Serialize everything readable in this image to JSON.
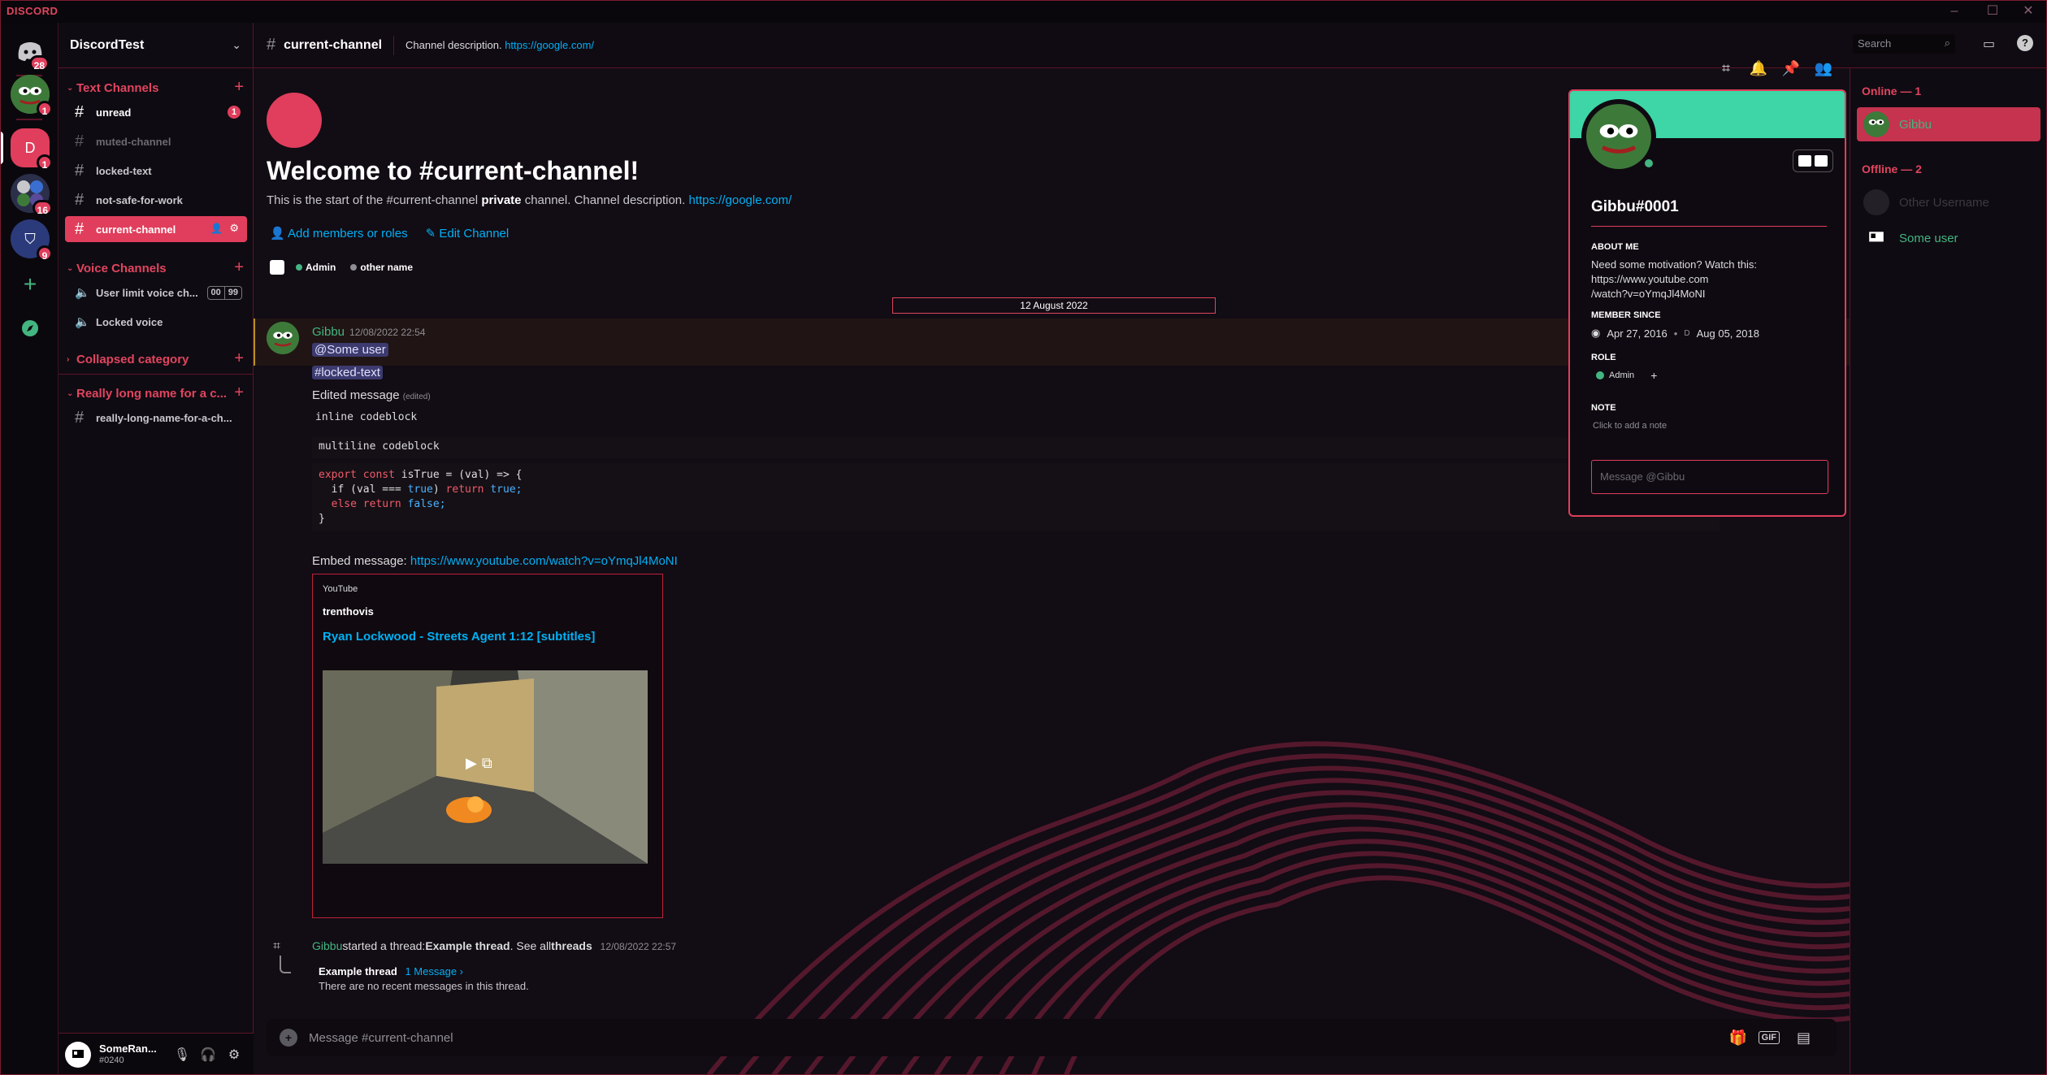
{
  "app": {
    "brand": "DISCORD"
  },
  "servers": {
    "home_badge": "28",
    "srv1_badge": "1",
    "srv2_initial": "D",
    "srv2_badge": "1",
    "srv3_badge": "16",
    "srv4_badge": "9"
  },
  "guild": {
    "name": "DiscordTest"
  },
  "categories": {
    "text": "Text Channels",
    "voice": "Voice Channels",
    "collapsed": "Collapsed category",
    "long": "Really long name for a c..."
  },
  "channels": {
    "unread": "unread",
    "unread_badge": "1",
    "muted": "muted-channel",
    "locked": "locked-text",
    "nsfw": "not-safe-for-work",
    "current": "current-channel",
    "voice_limit": "User limit voice ch...",
    "voice_limit_count": "00",
    "voice_limit_max": "99",
    "voice_locked": "Locked voice",
    "long_channel": "really-long-name-for-a-ch..."
  },
  "user": {
    "name": "SomeRan...",
    "tag": "#0240"
  },
  "topbar": {
    "channel": "current-channel",
    "description": "Channel description.",
    "link": "https://google.com/",
    "search_placeholder": "Search"
  },
  "welcome": {
    "title": "Welcome to #current-channel!",
    "sub_pre": "This is the start of the #current-channel",
    "sub_bold": "private",
    "sub_post": "channel. Channel description.",
    "sub_link": "https://google.com/",
    "add_members": "Add members or roles",
    "edit_channel": "Edit Channel",
    "role_admin": "Admin",
    "role_other": "other name"
  },
  "date_separator": "12 August 2022",
  "message": {
    "author": "Gibbu",
    "timestamp": "12/08/2022 22:54",
    "mention_user": "@Some user",
    "mention_channel": "#locked-text",
    "edited_text": "Edited message",
    "edited_tag": "(edited)",
    "inline_code": "inline codeblock",
    "multiline_code": "multiline codeblock",
    "code_line1_kw": "export const",
    "code_line1_rest": "isTrue = (val) => {",
    "code_line2_pre": "  if (val ===",
    "code_line2_true": "true",
    "code_line2_mid": ")",
    "code_line2_return": "return",
    "code_line2_val": "true;",
    "code_line3_kw": "  else return",
    "code_line3_val": "false;",
    "code_line4": "}",
    "embed_label": "Embed message:",
    "embed_link": "https://www.youtube.com/watch?v=oYmqJl4MoNI"
  },
  "embed": {
    "provider": "YouTube",
    "author": "trenthovis",
    "title": "Ryan Lockwood - Streets Agent 1:12 [subtitles]"
  },
  "thread": {
    "author": "Gibbu",
    "started": "started a thread:",
    "name": "Example thread",
    "see_all": ". See all",
    "threads": "threads",
    "timestamp": "12/08/2022 22:57",
    "card_title": "Example thread",
    "card_count": "1 Message ›",
    "card_sub": "There are no recent messages in this thread."
  },
  "composer": {
    "placeholder": "Message #current-channel",
    "gif": "GIF"
  },
  "profile": {
    "name": "Gibbu#0001",
    "about_label": "ABOUT ME",
    "about_text": "Need some motivation? Watch this:",
    "about_link1": "https://www.youtube.com",
    "about_link2": "/watch?v=oYmqJl4MoNI",
    "since_label": "MEMBER SINCE",
    "since_discord": "Apr 27, 2016",
    "since_server": "Aug 05, 2018",
    "role_label": "ROLE",
    "role_admin": "Admin",
    "note_label": "NOTE",
    "note_placeholder": "Click to add a note",
    "message_placeholder": "Message @Gibbu"
  },
  "members": {
    "online_label": "Online — 1",
    "online_user": "Gibbu",
    "offline_label": "Offline — 2",
    "offline_user1": "Other Username",
    "offline_user2": "Some user"
  },
  "colors": {
    "accent": "#e03e5c",
    "link": "#00b0f4",
    "online": "#43b581",
    "banner": "#3ed6a6"
  }
}
